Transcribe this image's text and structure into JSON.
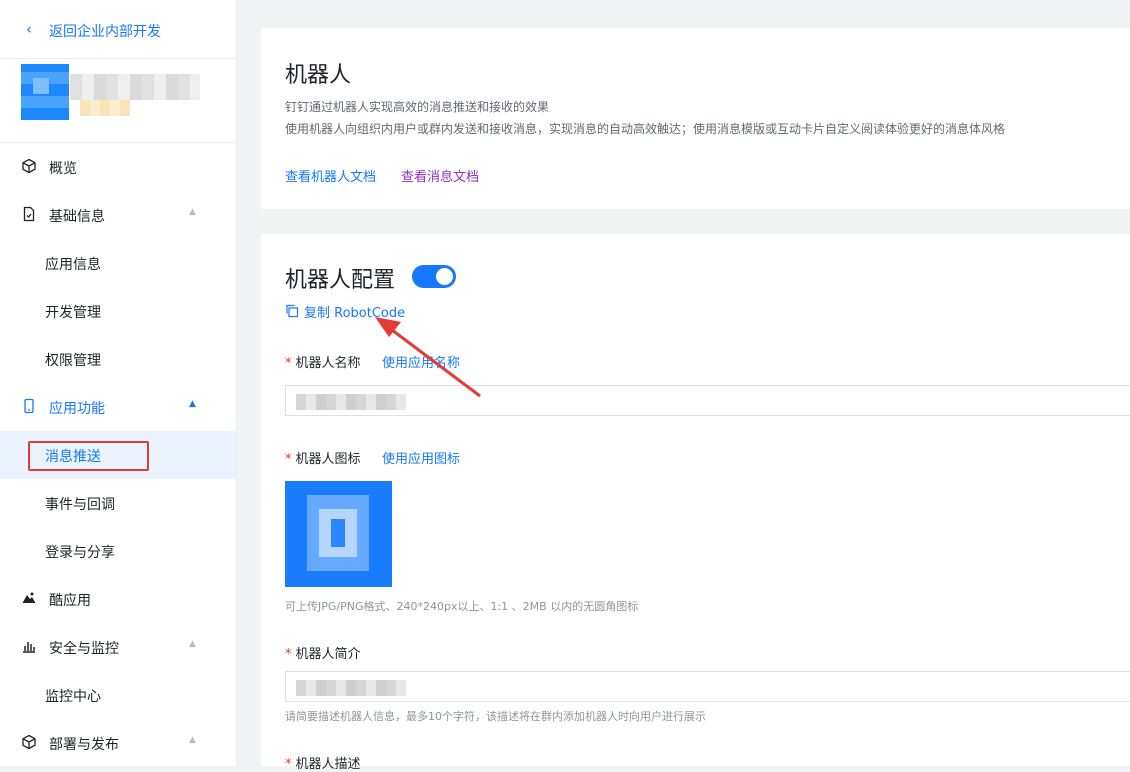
{
  "sidebar": {
    "back_label": "返回企业内部开发",
    "items": [
      {
        "label": "概览",
        "icon": "cube-icon"
      },
      {
        "label": "基础信息",
        "icon": "document-icon"
      },
      {
        "label": "应用信息"
      },
      {
        "label": "开发管理"
      },
      {
        "label": "权限管理"
      },
      {
        "label": "应用功能",
        "icon": "phone-icon"
      },
      {
        "label": "消息推送"
      },
      {
        "label": "事件与回调"
      },
      {
        "label": "登录与分享"
      },
      {
        "label": "酷应用",
        "icon": "mountain-icon"
      },
      {
        "label": "安全与监控",
        "icon": "bar-chart-icon"
      },
      {
        "label": "监控中心"
      },
      {
        "label": "部署与发布",
        "icon": "cube-icon"
      }
    ]
  },
  "intro": {
    "title": "机器人",
    "line1": "钉钉通过机器人实现高效的消息推送和接收的效果",
    "line2": "使用机器人向组织内用户或群内发送和接收消息，实现消息的自动高效触达；使用消息模版或互动卡片自定义阅读体验更好的消息体风格",
    "doc_link": "查看机器人文档",
    "msg_link": "查看消息文档"
  },
  "config": {
    "title": "机器人配置",
    "toggle_on": true,
    "copy_label": "复制 RobotCode",
    "name_label": "机器人名称",
    "use_app_name": "使用应用名称",
    "icon_label": "机器人图标",
    "use_app_icon": "使用应用图标",
    "icon_hint": "可上传JPG/PNG格式、240*240px以上、1:1 、2MB 以内的无圆角图标",
    "brief_label": "机器人简介",
    "brief_hint": "请简要描述机器人信息，最多10个字符，该描述将在群内添加机器人时向用户进行展示",
    "desc_label": "机器人描述"
  },
  "colors": {
    "accent": "#1677ff",
    "highlight": "#e53935"
  }
}
